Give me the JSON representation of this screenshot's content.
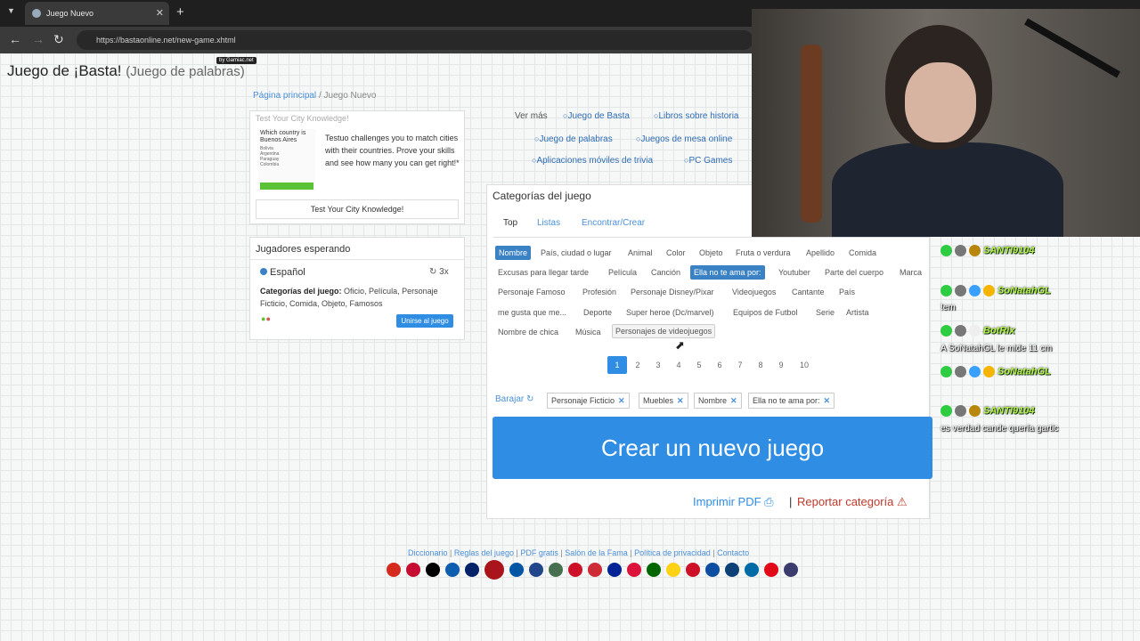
{
  "browser": {
    "tab_title": "Juego Nuevo",
    "url": "https://bastaonline.net/new-game.xhtml"
  },
  "page": {
    "title": "Juego de ¡Basta!",
    "subtitle": "(Juego de palabras)",
    "gamiac": "by Gamiac.net",
    "breadcrumb": {
      "home": "Página principal",
      "sep": "/",
      "current": "Juego Nuevo"
    }
  },
  "ad": {
    "title": "Test Your City Knowledge!",
    "image_question": "Which country is Buenos Aires",
    "image_options": [
      "Bolivia",
      "Argentina",
      "Paraguay",
      "Colombia"
    ],
    "text": "Testuo challenges you to match cities with their countries. Prove your skills and see how many you can get right!*",
    "button": "Test Your City Knowledge!"
  },
  "waiting": {
    "heading": "Jugadores esperando",
    "language": "Español",
    "count": "3x",
    "categories_label": "Categorías del juego:",
    "categories_value": "Oficio, Película, Personaje Ficticio, Comida, Objeto, Famosos",
    "join_button": "Unirse al juego"
  },
  "top_links": {
    "ver_mas": "Ver más",
    "items": [
      "Juego de Basta",
      "Libros sobre historia",
      "Juego de palabras",
      "Juegos de mesa online",
      "Aplicaciones móviles de trivia",
      "PC Games"
    ]
  },
  "categories": {
    "header": "Categorías del juego",
    "tabs": [
      "Top",
      "Listas",
      "Encontrar/Crear"
    ],
    "chips": [
      "Nombre",
      "País, ciudad o lugar",
      "Animal",
      "Color",
      "Objeto",
      "Fruta o verdura",
      "Apellido",
      "Comida",
      "Excusas para llegar tarde",
      "Película",
      "Canción",
      "Ella no te ama por:",
      "Youtuber",
      "Parte del cuerpo",
      "Marca",
      "Personaje Famoso",
      "Profesión",
      "Personaje Disney/Pixar",
      "Videojuegos",
      "Cantante",
      "País",
      "me gusta que me...",
      "Deporte",
      "Super heroe (Dc/marvel)",
      "Equipos de Futbol",
      "Serie",
      "Artista",
      "Nombre de chica",
      "Música",
      "Personajes de videojuegos"
    ],
    "pages": [
      "1",
      "2",
      "3",
      "4",
      "5",
      "6",
      "7",
      "8",
      "9",
      "10"
    ],
    "shuffle": "Barajar",
    "selected": [
      "Personaje Ficticio",
      "Muebles",
      "Nombre",
      "Ella no te ama por:"
    ],
    "create_button": "Crear un nuevo juego",
    "print_pdf": "Imprimir PDF",
    "pipe": "|",
    "report": "Reportar categoría"
  },
  "footer": {
    "links": [
      "Diccionario",
      "Reglas del juego",
      "PDF gratis",
      "Salón de la Fama",
      "Política de privacidad",
      "Contacto"
    ],
    "flag_colors": [
      "#d52b1e",
      "#c60c30",
      "#000000",
      "#0d5eaf",
      "#012169",
      "#aa151b",
      "#0055a4",
      "#21468b",
      "#477050",
      "#ce1126",
      "#ce2b37",
      "#002395",
      "#dc143c",
      "#006600",
      "#fcd116",
      "#ce1126",
      "#0b4ea2",
      "#0c4076",
      "#006aa7",
      "#e30a17",
      "#3c3b6e"
    ]
  },
  "chat": {
    "messages": [
      {
        "user": "SANTI9104",
        "text": ""
      },
      {
        "user": "SoNatahGL",
        "text": "!em"
      },
      {
        "user": "BotRix",
        "text": "A SoNatahGL le mide 11 cm"
      },
      {
        "user": "SoNatahGL",
        "text": ""
      },
      {
        "user": "SANTI9104",
        "text": "es verdad cande quería gartic"
      }
    ]
  }
}
